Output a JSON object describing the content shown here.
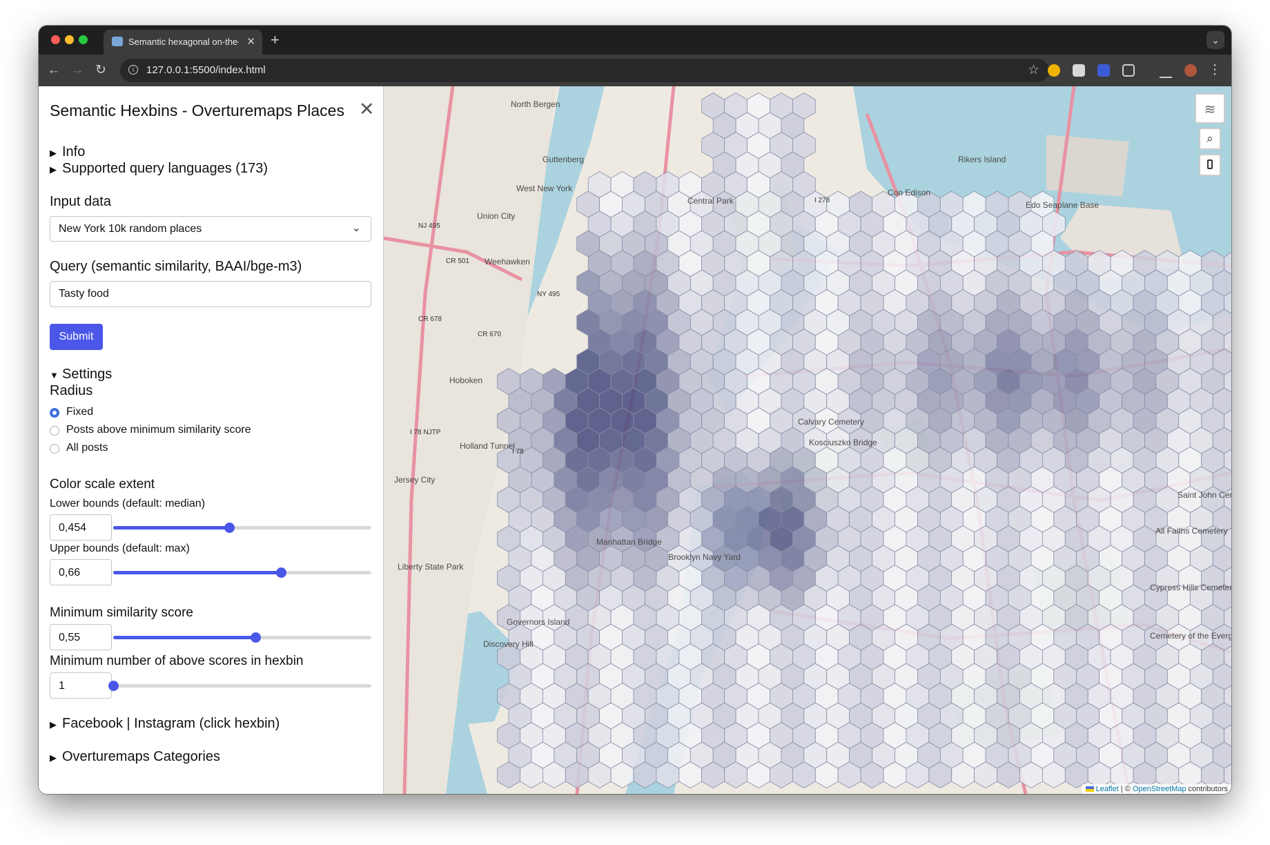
{
  "browser": {
    "tab_title": "Semantic hexagonal on-the-f",
    "tab_close": "✕",
    "new_tab": "+",
    "url": "127.0.0.1:5500/index.html"
  },
  "panel": {
    "title": "Semantic Hexbins - Overturemaps Places",
    "close_label": "✕",
    "info_summary": "Info",
    "languages_summary": "Supported query languages (173)",
    "input_data_label": "Input data",
    "input_data_value": "New York 10k random places",
    "query_label": "Query (semantic similarity, BAAI/bge-m3)",
    "query_value": "Tasty food",
    "submit_label": "Submit",
    "settings_summary": "Settings",
    "radius_label": "Radius",
    "radius_options": [
      "Fixed",
      "Posts above minimum similarity score",
      "All posts"
    ],
    "radius_selected": "Fixed",
    "color_scale_label": "Color scale extent",
    "lower_label": "Lower bounds (default: median)",
    "lower_value": "0,454",
    "lower_fraction": 0.45,
    "upper_label": "Upper bounds (default: max)",
    "upper_value": "0,66",
    "upper_fraction": 0.65,
    "min_sim_label": "Minimum similarity score",
    "min_sim_value": "0,55",
    "min_sim_fraction": 0.55,
    "min_count_label": "Minimum number of above scores in hexbin",
    "min_count_value": "1",
    "min_count_fraction": 0.0,
    "facebook_summary": "Facebook | Instagram (click hexbin)",
    "categories_summary": "Overturemaps Categories"
  },
  "map": {
    "labels": [
      "North Bergen",
      "Guttenberg",
      "West New York",
      "Union City",
      "Weehawken",
      "Hoboken",
      "Jersey City",
      "Rikers Island",
      "Con Edison",
      "Edo Seaplane Base",
      "Calvary Cemetery",
      "Kosciuszko Bridge",
      "Manhattan Bridge",
      "Brooklyn Navy Yard",
      "Governors Island",
      "Liberty State Park",
      "Cypress Hills Cemetery",
      "Saint John Cemetery",
      "All Faiths Cemetery",
      "Cemetery of the Evergreens",
      "Discovery Hill",
      "Central Park",
      "Holland Tunnel",
      "NJ 495",
      "NY 495",
      "CR 501",
      "CR 678",
      "CR 670",
      "I 78 NJTP",
      "I 278",
      "I 78"
    ],
    "attribution_leaflet": "Leaflet",
    "attribution_sep": " | © ",
    "attribution_osm": "OpenStreetMap",
    "attribution_tail": " contributors",
    "colors": {
      "water": "#aad3df",
      "land": "#eeeae2",
      "hex_low": "#f4f4f8",
      "hex_high": "#4a4f80",
      "accent": "#4a57e8"
    }
  }
}
